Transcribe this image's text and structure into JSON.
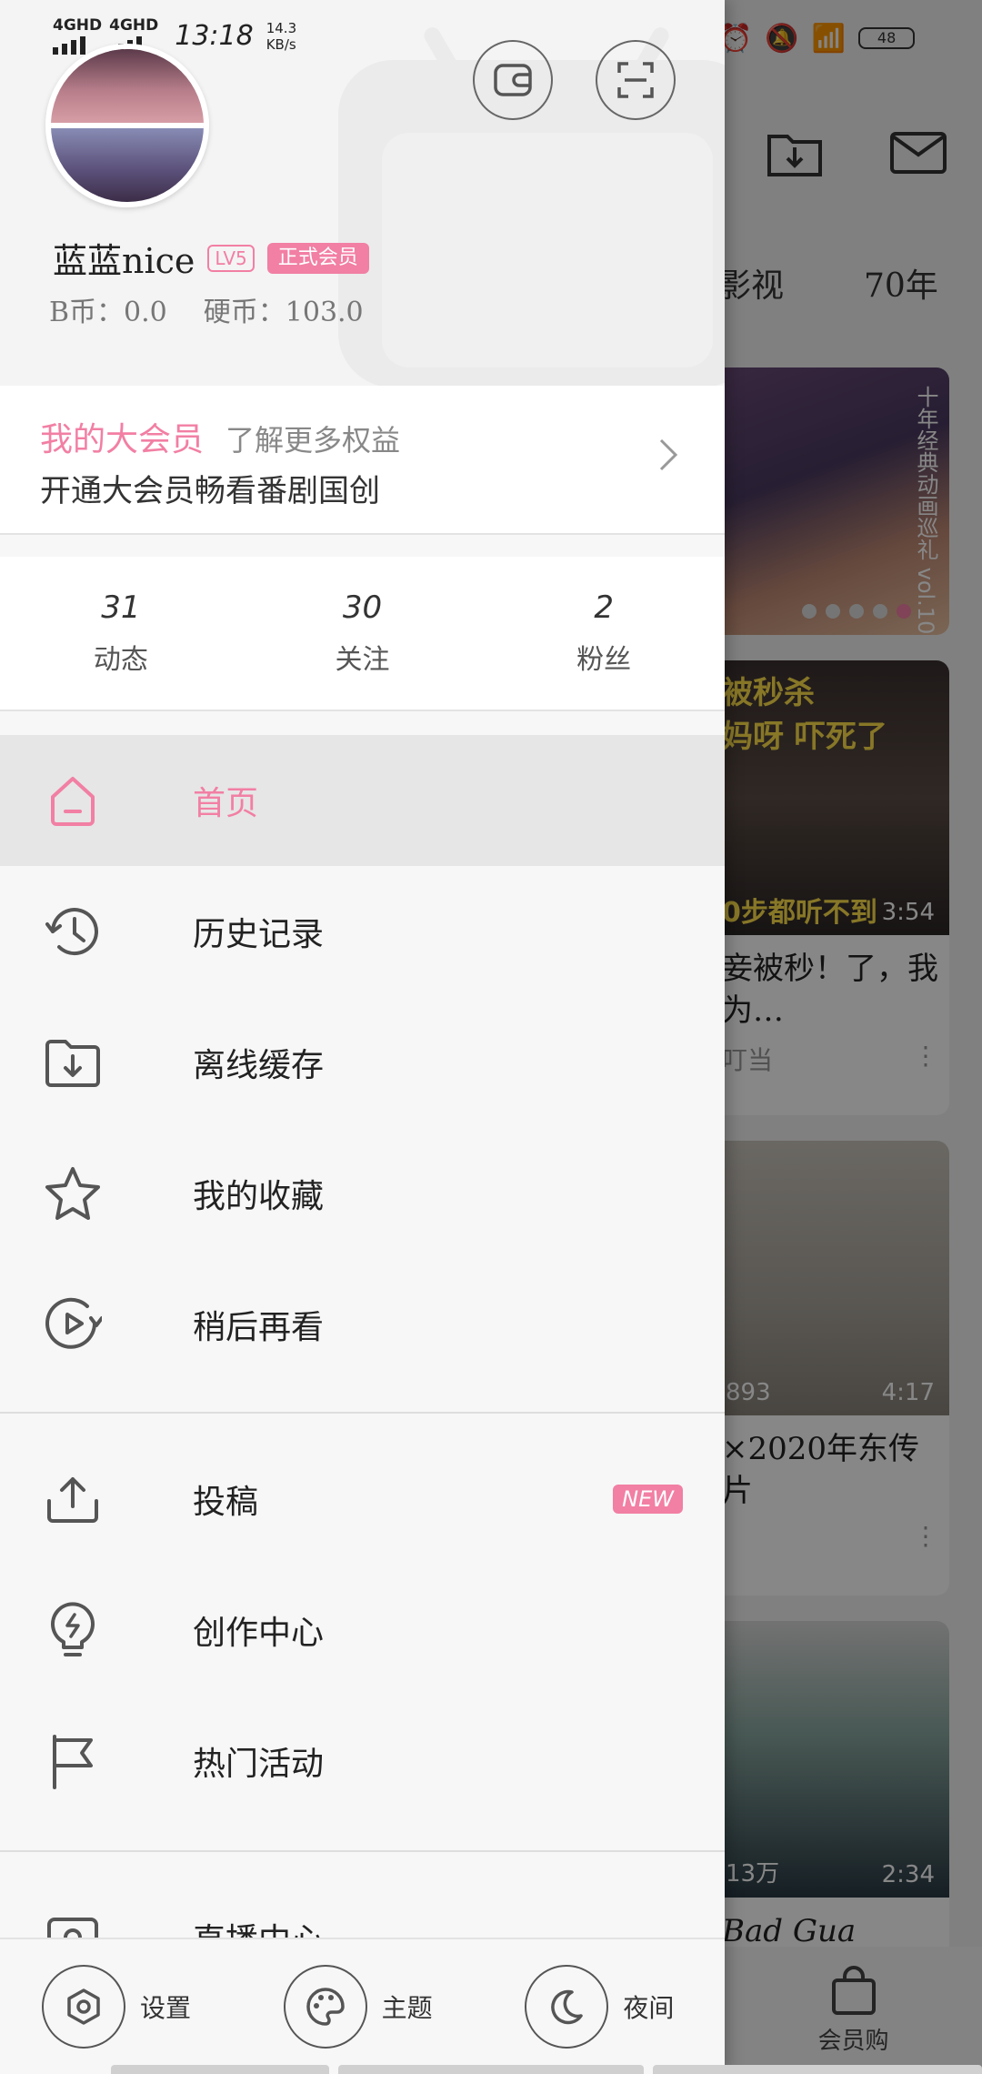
{
  "status_bar": {
    "network_1": "4GHD",
    "network_2": "4GHD",
    "time": "13:18",
    "speed_value": "14.3",
    "speed_unit": "KB/s",
    "battery": "48"
  },
  "profile": {
    "username": "蓝蓝nice",
    "level": "LV5",
    "vip_badge": "正式会员",
    "b_coin": "B币：0.0",
    "hard_coin": "硬币：103.0"
  },
  "vip_card": {
    "title": "我的大会员",
    "more": "了解更多权益",
    "subtitle": "开通大会员畅看番剧国创"
  },
  "stats": [
    {
      "count": "31",
      "label": "动态"
    },
    {
      "count": "30",
      "label": "关注"
    },
    {
      "count": "2",
      "label": "粉丝"
    }
  ],
  "menu_group_1": [
    {
      "label": "首页",
      "icon": "home-icon"
    },
    {
      "label": "历史记录",
      "icon": "history-icon"
    },
    {
      "label": "离线缓存",
      "icon": "offline-cache-icon"
    },
    {
      "label": "我的收藏",
      "icon": "star-icon"
    },
    {
      "label": "稍后再看",
      "icon": "watch-later-icon"
    }
  ],
  "menu_group_2": [
    {
      "label": "投稿",
      "icon": "upload-icon",
      "badge": "NEW"
    },
    {
      "label": "创作中心",
      "icon": "lightbulb-icon"
    },
    {
      "label": "热门活动",
      "icon": "flag-icon"
    }
  ],
  "menu_group_3": [
    {
      "label": "直播中心",
      "icon": "live-icon"
    }
  ],
  "bottom_bar": {
    "settings": "设置",
    "theme": "主题",
    "night": "夜间"
  },
  "background": {
    "tabs": [
      "影视",
      "70年"
    ],
    "card1_side_text": "十年经典动画巡礼 vol.10",
    "card2_caption_top": "被秒杀",
    "card2_caption_mid": "妈呀 吓死了",
    "card2_caption_bottom": "0步都听不到",
    "card2_duration": "3:54",
    "card2_title": "妾被秒！了，我为…",
    "card2_author": "叮当",
    "card3_count": "893",
    "card3_duration": "4:17",
    "card3_title": "×2020年东传片",
    "card4_count": "13万",
    "card4_duration": "2:34",
    "card4_title": "Bad Gua",
    "bottom_nav_label": "会员购"
  },
  "colors": {
    "accent": "#f27fa4",
    "drawer_bg": "#f7f7f7",
    "active_row": "#e6e6e6"
  }
}
